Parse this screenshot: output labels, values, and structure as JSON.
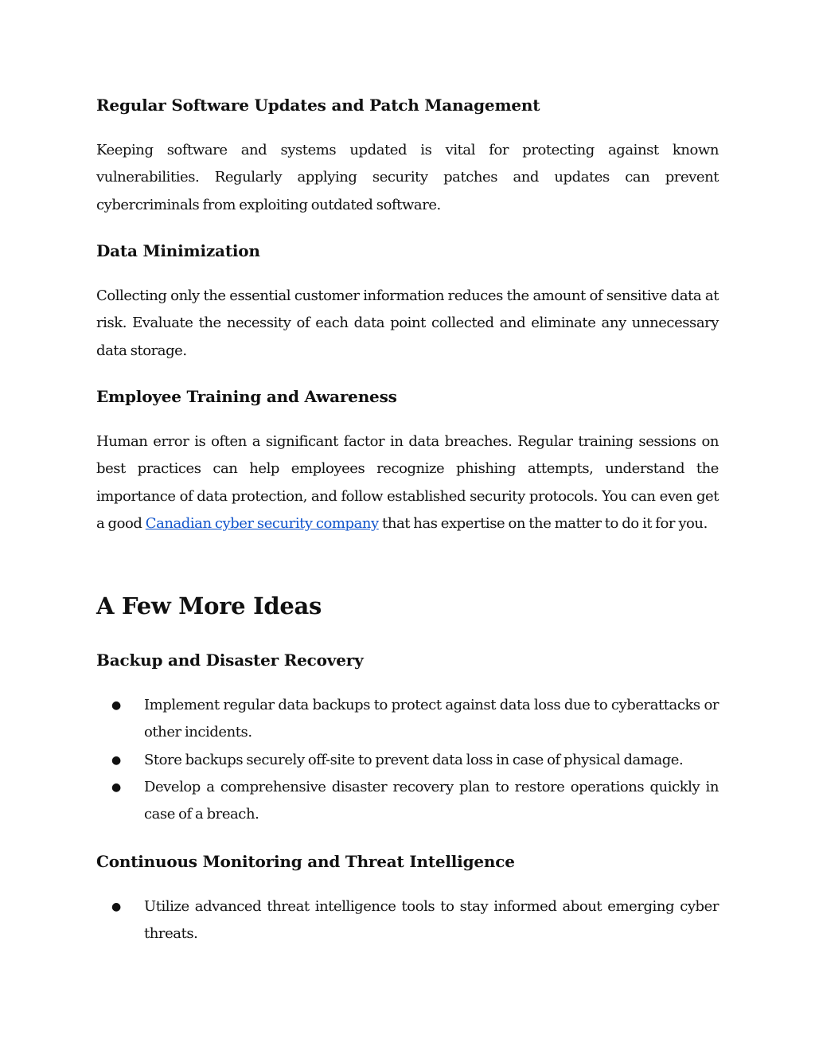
{
  "sections": [
    {
      "heading": "Regular Software Updates and Patch Management",
      "body": "Keeping software and systems updated is vital for protecting against known vulnerabilities. Regularly applying security patches and updates can prevent cybercriminals from exploiting outdated software."
    },
    {
      "heading": "Data Minimization",
      "body": "Collecting only the essential customer information reduces the amount of sensitive data at risk. Evaluate the necessity of each data point collected and eliminate any unnecessary data storage."
    },
    {
      "heading": "Employee Training and Awareness",
      "body_before_link": "Human error is often a significant factor in data breaches. Regular training sessions on best practices can help employees recognize phishing attempts, understand the importance of data protection, and follow established security protocols. You can even get a good ",
      "link_text": "Canadian cyber security company",
      "body_after_link": " that has expertise on the matter to do it for you."
    }
  ],
  "main_heading": "A Few More Ideas",
  "subsections": [
    {
      "heading": "Backup and Disaster Recovery",
      "bullets": [
        "Implement regular data backups to protect against data loss due to cyberattacks or other incidents.",
        "Store backups securely off-site to prevent data loss in case of physical damage.",
        "Develop a comprehensive disaster recovery plan to restore operations quickly in case of a breach."
      ]
    },
    {
      "heading": "Continuous Monitoring and Threat Intelligence",
      "bullets": [
        "Utilize advanced threat intelligence tools to stay informed about emerging cyber threats."
      ]
    }
  ],
  "bullet_glyph": "●",
  "link_color": "#1155cc"
}
